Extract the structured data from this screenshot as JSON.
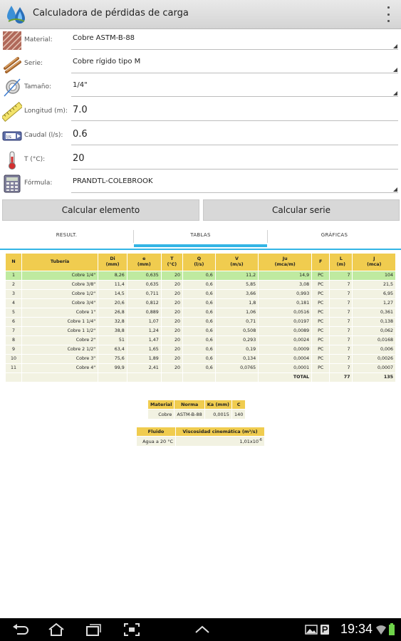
{
  "app": {
    "title": "Calculadora de pérdidas de carga"
  },
  "form": {
    "material": {
      "label": "Material:",
      "value": "Cobre ASTM-B-88"
    },
    "serie": {
      "label": "Serie:",
      "value": "Cobre rígido tipo M"
    },
    "tamano": {
      "label": "Tamaño:",
      "value": "1/4\""
    },
    "longitud": {
      "label": "Longitud (m):",
      "value": "7.0"
    },
    "caudal": {
      "label": "Caudal (l/s):",
      "value": "0.6"
    },
    "temperatura": {
      "label": "T (°C):",
      "value": "20"
    },
    "formula": {
      "label": "Fórmula:",
      "value": "PRANDTL-COLEBROOK"
    }
  },
  "buttons": {
    "calc_elemento": "Calcular elemento",
    "calc_serie": "Calcular serie"
  },
  "tabs": [
    "RESULT.",
    "TABLAS",
    "GRÁFICAS"
  ],
  "table": {
    "headers": [
      {
        "t": "N",
        "u": ""
      },
      {
        "t": "Tubería",
        "u": ""
      },
      {
        "t": "Di",
        "u": "(mm)"
      },
      {
        "t": "e",
        "u": "(mm)"
      },
      {
        "t": "T",
        "u": "(°C)"
      },
      {
        "t": "Q",
        "u": "(l/s)"
      },
      {
        "t": "V",
        "u": "(m/s)"
      },
      {
        "t": "Ju",
        "u": "(mca/m)"
      },
      {
        "t": "F",
        "u": ""
      },
      {
        "t": "L",
        "u": "(m)"
      },
      {
        "t": "J",
        "u": "(mca)"
      }
    ],
    "rows": [
      [
        "1",
        "Cobre 1/4\"",
        "8,26",
        "0,635",
        "20",
        "0,6",
        "11,2",
        "14,9",
        "PC",
        "7",
        "104"
      ],
      [
        "2",
        "Cobre 3/8\"",
        "11,4",
        "0,635",
        "20",
        "0,6",
        "5,85",
        "3,08",
        "PC",
        "7",
        "21,5"
      ],
      [
        "3",
        "Cobre 1/2\"",
        "14,5",
        "0,711",
        "20",
        "0,6",
        "3,66",
        "0,993",
        "PC",
        "7",
        "6,95"
      ],
      [
        "4",
        "Cobre 3/4\"",
        "20,6",
        "0,812",
        "20",
        "0,6",
        "1,8",
        "0,181",
        "PC",
        "7",
        "1,27"
      ],
      [
        "5",
        "Cobre 1\"",
        "26,8",
        "0,889",
        "20",
        "0,6",
        "1,06",
        "0,0516",
        "PC",
        "7",
        "0,361"
      ],
      [
        "6",
        "Cobre 1 1/4\"",
        "32,8",
        "1,07",
        "20",
        "0,6",
        "0,71",
        "0,0197",
        "PC",
        "7",
        "0,138"
      ],
      [
        "7",
        "Cobre 1 1/2\"",
        "38,8",
        "1,24",
        "20",
        "0,6",
        "0,508",
        "0,0089",
        "PC",
        "7",
        "0,062"
      ],
      [
        "8",
        "Cobre 2\"",
        "51",
        "1,47",
        "20",
        "0,6",
        "0,293",
        "0,0024",
        "PC",
        "7",
        "0,0168"
      ],
      [
        "9",
        "Cobre 2 1/2\"",
        "63,4",
        "1,65",
        "20",
        "0,6",
        "0,19",
        "0,0009",
        "PC",
        "7",
        "0,006"
      ],
      [
        "10",
        "Cobre 3\"",
        "75,6",
        "1,89",
        "20",
        "0,6",
        "0,134",
        "0,0004",
        "PC",
        "7",
        "0,0026"
      ],
      [
        "11",
        "Cobre 4\"",
        "99,9",
        "2,41",
        "20",
        "0,6",
        "0,0765",
        "0,0001",
        "PC",
        "7",
        "0,0007"
      ]
    ],
    "total": {
      "label": "TOTAL",
      "L": "77",
      "J": "135"
    }
  },
  "material_table": {
    "headers": [
      "Material",
      "Norma",
      "Ka (mm)",
      "C"
    ],
    "row": [
      "Cobre",
      "ASTM-B-88",
      "0,0015",
      "140"
    ]
  },
  "fluid_table": {
    "headers": [
      "Fluido",
      "Viscosidad cinemática (m²/s)"
    ],
    "row": [
      "Agua a 20 °C",
      "1,01x10",
      "-6"
    ]
  },
  "status": {
    "clock": "19:34"
  }
}
